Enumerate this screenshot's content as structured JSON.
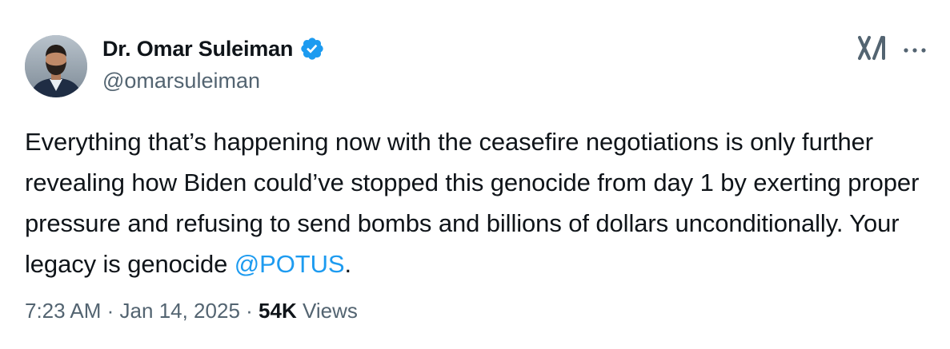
{
  "author": {
    "display_name": "Dr. Omar Suleiman",
    "handle": "@omarsuleiman",
    "verified": true,
    "verified_color": "#1d9bf0"
  },
  "tweet": {
    "text_before_mention": "Everything that’s happening now with the ceasefire negotiations is only further revealing how Biden could’ve stopped this genocide from day 1 by exerting proper pressure and refusing to send bombs and billions of dollars unconditionally. Your legacy is genocide ",
    "mention": "@POTUS",
    "text_after_mention": ".",
    "mention_color": "#1d9bf0"
  },
  "meta": {
    "time": "7:23 AM",
    "separator": "·",
    "date": "Jan 14, 2025",
    "views_count": "54K",
    "views_label": "Views"
  },
  "icons": {
    "brand": "x-logo-icon",
    "more": "more-options-icon",
    "verified": "verified-badge-icon"
  }
}
